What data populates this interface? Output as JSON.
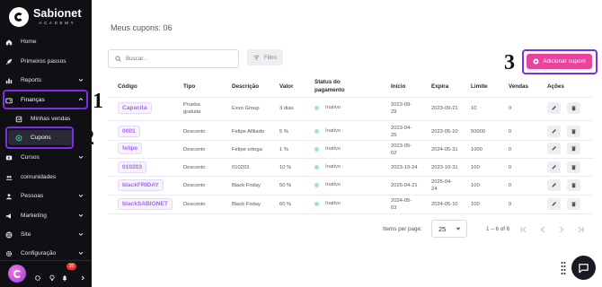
{
  "brand": {
    "name": "Sabionet",
    "sub": "ACADEMY"
  },
  "sidebar": {
    "items": [
      {
        "label": "Home",
        "icon": "home-icon"
      },
      {
        "label": "Primeiros passos",
        "icon": "rocket-icon"
      },
      {
        "label": "Reports",
        "icon": "reports-icon"
      },
      {
        "label": "Finanças",
        "icon": "wallet-icon"
      },
      {
        "label": "Minhas vendas",
        "icon": "sales-icon"
      },
      {
        "label": "Cupons",
        "icon": "coupon-icon"
      },
      {
        "label": "Cursos",
        "icon": "courses-icon"
      },
      {
        "label": "comunidades",
        "icon": "community-icon"
      },
      {
        "label": "Pessoas",
        "icon": "people-icon"
      },
      {
        "label": "Marketing",
        "icon": "marketing-icon"
      },
      {
        "label": "Site",
        "icon": "globe-icon"
      },
      {
        "label": "Configuração",
        "icon": "gear-icon"
      }
    ],
    "footer": {
      "notification_count": "20"
    }
  },
  "annotations": [
    "1",
    "2",
    "3"
  ],
  "main": {
    "title": "Meus cupons: 06",
    "search_placeholder": "Buscar...",
    "filter_label": "Filtro",
    "add_button_label": "Adicionar cupom",
    "columns": [
      "Código",
      "Tipo",
      "Descrição",
      "Valor",
      "Status do\npagamento",
      "Início",
      "Expira",
      "Limite",
      "Vendas",
      "Ações"
    ],
    "rows": [
      {
        "code": "Capacita",
        "type": "Prueba\ngratuita",
        "desc": "Exxo Group",
        "value": "3 dias",
        "status": "Inativo",
        "start": "2023-09-\n29",
        "end": "2023-09-21",
        "limit": "10",
        "sales": "0"
      },
      {
        "code": "0001",
        "type": "Desconto",
        "desc": "Felipe Afiliado",
        "value": "5 %",
        "status": "Inativo",
        "start": "2023-04-\n25",
        "end": "2023-05-10",
        "limit": "50000",
        "sales": "0"
      },
      {
        "code": "felipe",
        "type": "Desconto",
        "desc": "Felipe ortega",
        "value": "1 %",
        "status": "Inativo",
        "start": "2023-05-\n02",
        "end": "2024-05-31",
        "limit": "1000",
        "sales": "0"
      },
      {
        "code": "010203",
        "type": "Desconto",
        "desc": "010203",
        "value": "10 %",
        "status": "Inativo",
        "start": "2023-10-24",
        "end": "2023-10-31",
        "limit": "100",
        "sales": "0"
      },
      {
        "code": "blackFRIDAY",
        "type": "Desconto",
        "desc": "Black Friday",
        "value": "50 %",
        "status": "Inativo",
        "start": "2025-04-21",
        "end": "2025-04-\n24",
        "limit": "100",
        "sales": "0"
      },
      {
        "code": "blackSABIONET",
        "type": "Desconto",
        "desc": "Black Friday",
        "value": "60 %",
        "status": "Inativo",
        "start": "2024-05-\n03",
        "end": "2024-05-10",
        "limit": "100",
        "sales": "0"
      }
    ],
    "pagination": {
      "items_label": "Items per page:",
      "per_page": "25",
      "range": "1 – 6 of 6"
    }
  }
}
